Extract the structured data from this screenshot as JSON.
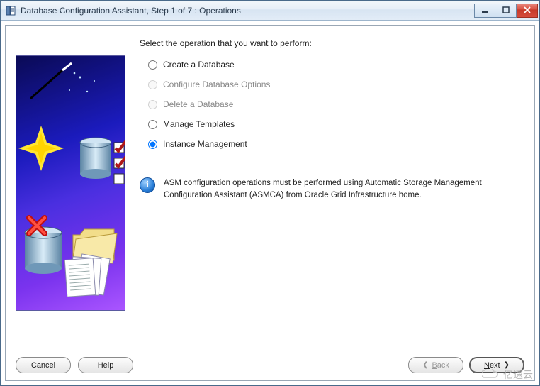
{
  "window": {
    "title": "Database Configuration Assistant, Step 1 of 7 : Operations"
  },
  "instruction": "Select the operation that you want to perform:",
  "options": [
    {
      "id": "create",
      "label": "Create a Database",
      "selected": false,
      "disabled": false
    },
    {
      "id": "config",
      "label": "Configure Database Options",
      "selected": false,
      "disabled": true
    },
    {
      "id": "delete",
      "label": "Delete a Database",
      "selected": false,
      "disabled": true
    },
    {
      "id": "template",
      "label": "Manage Templates",
      "selected": false,
      "disabled": false
    },
    {
      "id": "instance",
      "label": "Instance Management",
      "selected": true,
      "disabled": false
    }
  ],
  "info_note": "ASM configuration operations must be performed using Automatic Storage Management Configuration Assistant (ASMCA) from Oracle Grid Infrastructure home.",
  "buttons": {
    "cancel": "Cancel",
    "help": "Help",
    "back": "Back",
    "next": "Next"
  },
  "watermark": "亿速云"
}
